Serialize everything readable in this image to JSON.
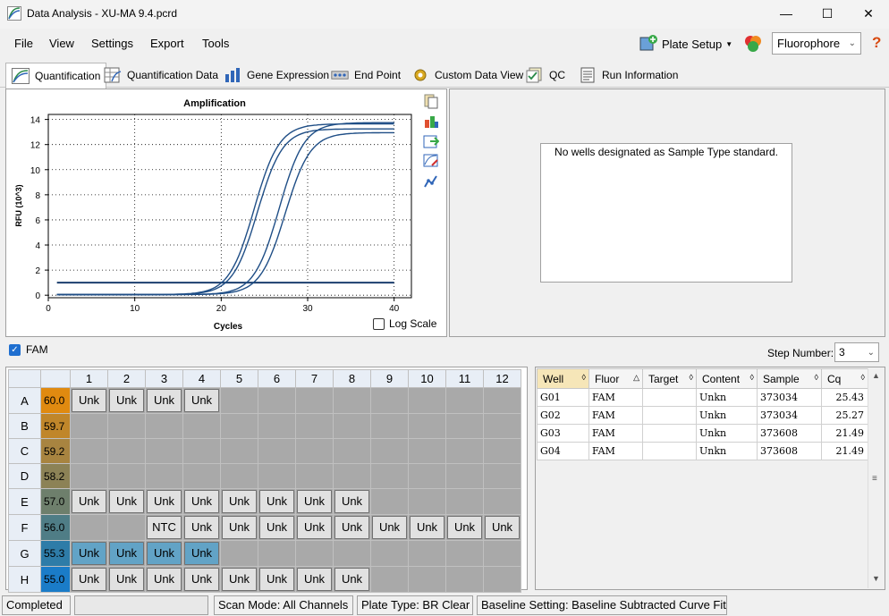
{
  "window": {
    "title": "Data Analysis - XU-MA 9.4.pcrd"
  },
  "menu": [
    "File",
    "View",
    "Settings",
    "Export",
    "Tools"
  ],
  "toolbar": {
    "plate_setup": "Plate Setup",
    "fluorophore": "Fluorophore",
    "help": "?"
  },
  "tabs": [
    {
      "label": "Quantification",
      "icon": "amplification-icon"
    },
    {
      "label": "Quantification Data",
      "icon": "data-table-icon"
    },
    {
      "label": "Gene Expression",
      "icon": "bar-chart-icon"
    },
    {
      "label": "End Point",
      "icon": "endpoint-icon"
    },
    {
      "label": "Custom Data View",
      "icon": "gear-icon"
    },
    {
      "label": "QC",
      "icon": "qc-icon"
    },
    {
      "label": "Run Information",
      "icon": "document-icon"
    }
  ],
  "chart_data": {
    "type": "line",
    "title": "Amplification",
    "xlabel": "Cycles",
    "ylabel": "RFU (10^3)",
    "xlim": [
      0,
      42
    ],
    "ylim": [
      -0.2,
      14.4
    ],
    "xticks": [
      0,
      10,
      20,
      30,
      40
    ],
    "yticks": [
      0,
      2,
      4,
      6,
      8,
      10,
      12,
      14
    ],
    "grid": true,
    "threshold": 1.0,
    "series": [
      {
        "well": "G01",
        "midpoint": 26.7,
        "plateau": 13.7
      },
      {
        "well": "G02",
        "midpoint": 27.4,
        "plateau": 12.9
      },
      {
        "well": "G03",
        "midpoint": 23.8,
        "plateau": 13.6
      },
      {
        "well": "G04",
        "midpoint": 24.2,
        "plateau": 13.2
      }
    ],
    "log_scale_label": "Log Scale",
    "log_scale_checked": false
  },
  "standard_curve": {
    "message": "No wells designated as Sample Type standard."
  },
  "fluor_filter": {
    "label": "FAM",
    "checked": true
  },
  "step_number": {
    "label": "Step Number:",
    "value": "3"
  },
  "plate": {
    "columns": [
      "1",
      "2",
      "3",
      "4",
      "5",
      "6",
      "7",
      "8",
      "9",
      "10",
      "11",
      "12"
    ],
    "rows": [
      {
        "label": "A",
        "temp": "60.0",
        "color": "#e08a10",
        "wells": [
          "Unk",
          "Unk",
          "Unk",
          "Unk",
          "",
          "",
          "",
          "",
          "",
          "",
          "",
          ""
        ],
        "selected": []
      },
      {
        "label": "B",
        "temp": "59.7",
        "color": "#c0862a",
        "wells": [
          "",
          "",
          "",
          "",
          "",
          "",
          "",
          "",
          "",
          "",
          "",
          ""
        ],
        "selected": []
      },
      {
        "label": "C",
        "temp": "59.2",
        "color": "#a88440",
        "wells": [
          "",
          "",
          "",
          "",
          "",
          "",
          "",
          "",
          "",
          "",
          "",
          ""
        ],
        "selected": []
      },
      {
        "label": "D",
        "temp": "58.2",
        "color": "#8c8256",
        "wells": [
          "",
          "",
          "",
          "",
          "",
          "",
          "",
          "",
          "",
          "",
          "",
          ""
        ],
        "selected": []
      },
      {
        "label": "E",
        "temp": "57.0",
        "color": "#6e7f6c",
        "wells": [
          "Unk",
          "Unk",
          "Unk",
          "Unk",
          "Unk",
          "Unk",
          "Unk",
          "Unk",
          "",
          "",
          "",
          ""
        ],
        "selected": []
      },
      {
        "label": "F",
        "temp": "56.0",
        "color": "#4f7d86",
        "wells": [
          "",
          "",
          "NTC",
          "Unk",
          "Unk",
          "Unk",
          "Unk",
          "Unk",
          "Unk",
          "Unk",
          "Unk",
          "Unk"
        ],
        "selected": []
      },
      {
        "label": "G",
        "temp": "55.3",
        "color": "#2e7ca8",
        "wells": [
          "Unk",
          "Unk",
          "Unk",
          "Unk",
          "",
          "",
          "",
          "",
          "",
          "",
          "",
          ""
        ],
        "selected": [
          0,
          1,
          2,
          3
        ]
      },
      {
        "label": "H",
        "temp": "55.0",
        "color": "#1a7cc8",
        "wells": [
          "Unk",
          "Unk",
          "Unk",
          "Unk",
          "Unk",
          "Unk",
          "Unk",
          "Unk",
          "",
          "",
          "",
          ""
        ],
        "selected": []
      }
    ]
  },
  "well_table": {
    "headers": [
      "Well",
      "Fluor",
      "Target",
      "Content",
      "Sample",
      "Cq"
    ],
    "rows": [
      [
        "G01",
        "FAM",
        "",
        "Unkn",
        "373034",
        "25.43"
      ],
      [
        "G02",
        "FAM",
        "",
        "Unkn",
        "373034",
        "25.27"
      ],
      [
        "G03",
        "FAM",
        "",
        "Unkn",
        "373608",
        "21.49"
      ],
      [
        "G04",
        "FAM",
        "",
        "Unkn",
        "373608",
        "21.49"
      ]
    ]
  },
  "status": {
    "state": "Completed",
    "scan_mode": "Scan Mode: All Channels",
    "plate_type": "Plate Type: BR Clear",
    "baseline": "Baseline Setting: Baseline Subtracted Curve Fit"
  }
}
